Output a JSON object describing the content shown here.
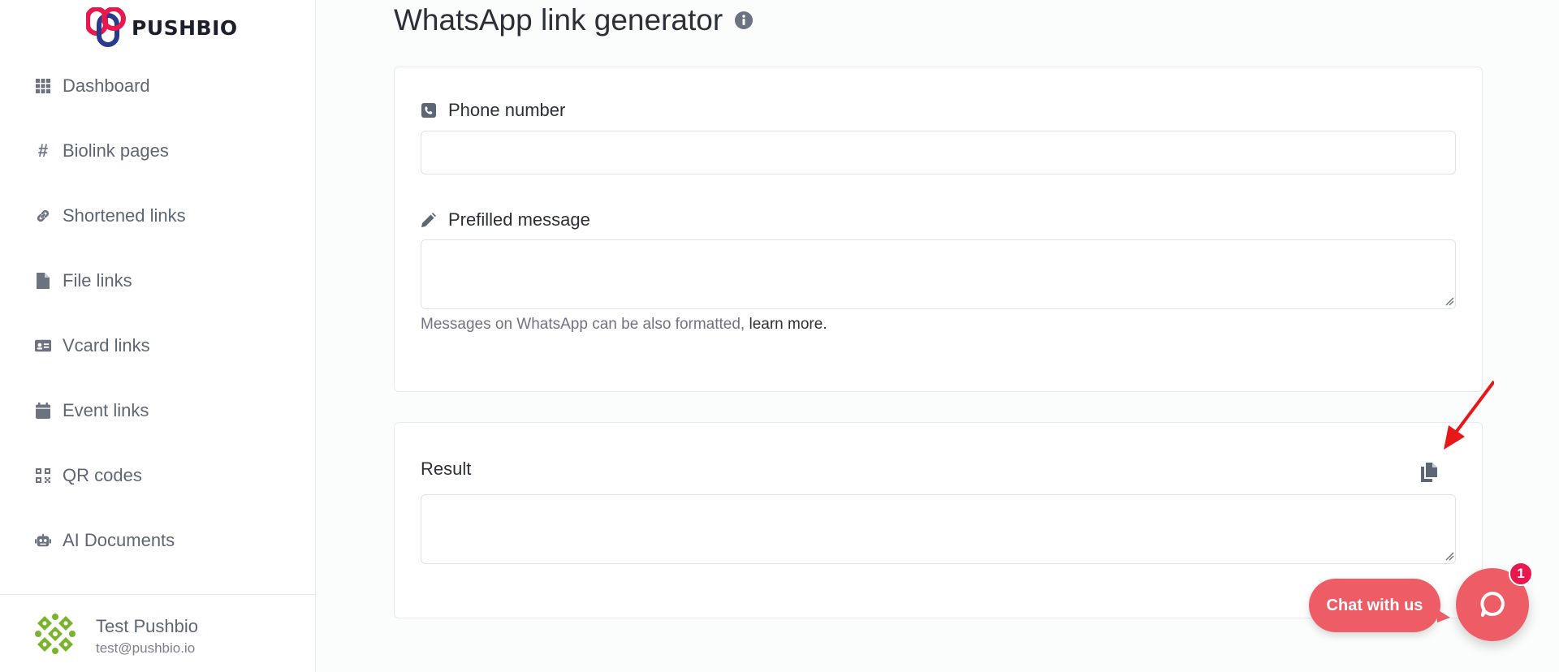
{
  "brand": {
    "name": "PUSHBIO"
  },
  "sidebar": {
    "items": [
      {
        "label": "Dashboard",
        "icon": "grid-icon"
      },
      {
        "label": "Biolink pages",
        "icon": "hashtag-icon"
      },
      {
        "label": "Shortened links",
        "icon": "link-icon"
      },
      {
        "label": "File links",
        "icon": "file-icon"
      },
      {
        "label": "Vcard links",
        "icon": "id-card-icon"
      },
      {
        "label": "Event links",
        "icon": "calendar-icon"
      },
      {
        "label": "QR codes",
        "icon": "qrcode-icon"
      },
      {
        "label": "AI Documents",
        "icon": "robot-icon"
      }
    ],
    "user": {
      "name": "Test Pushbio",
      "email": "test@pushbio.io"
    }
  },
  "page": {
    "title": "WhatsApp link generator",
    "form": {
      "phone_label": "Phone number",
      "phone_value": "",
      "message_label": "Prefilled message",
      "message_value": "",
      "help_text": "Messages on WhatsApp can be also formatted,",
      "help_link": "learn more."
    },
    "result": {
      "label": "Result",
      "value": ""
    }
  },
  "chat": {
    "label": "Chat with us",
    "badge": "1"
  },
  "colors": {
    "accent": "#ee5d66",
    "badge": "#e8184f",
    "annotation_arrow": "#e81818"
  }
}
